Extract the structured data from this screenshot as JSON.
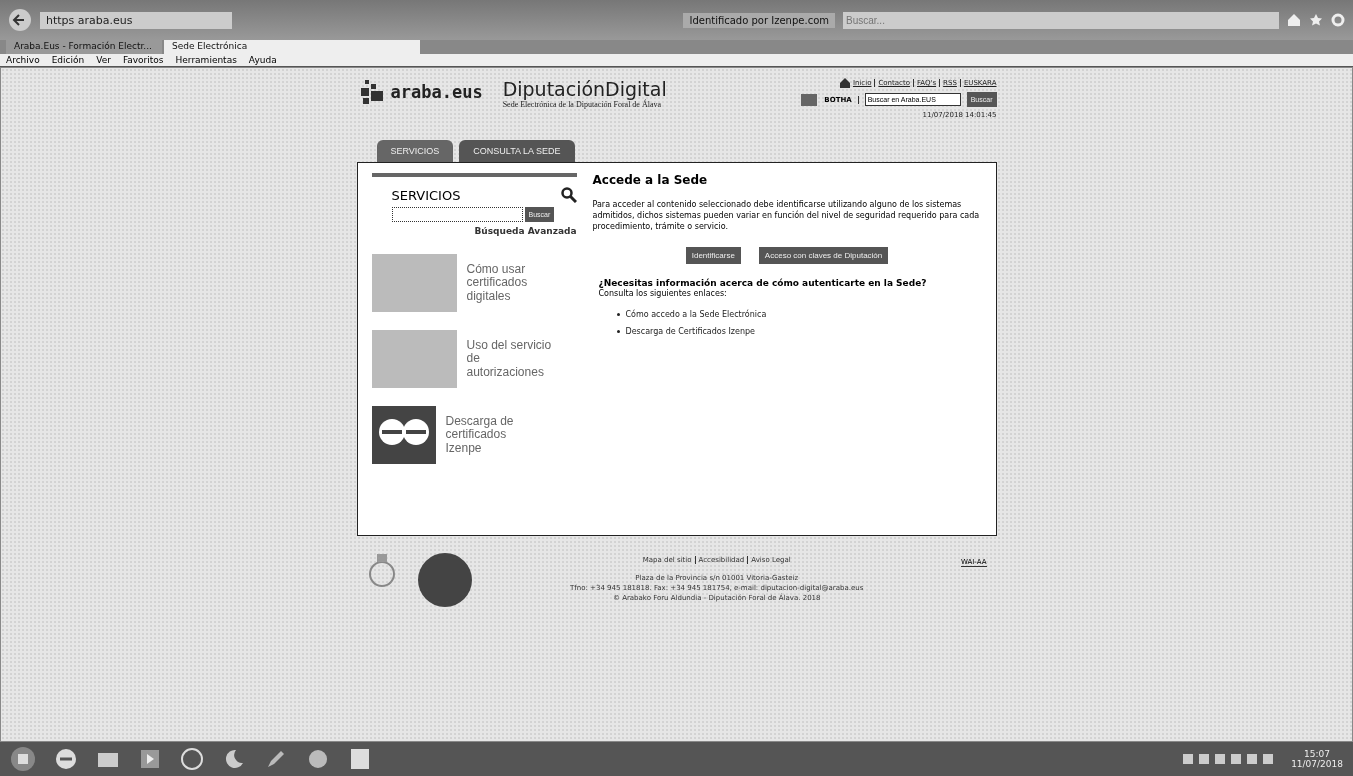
{
  "browser": {
    "address": "https   araba.eus",
    "identity": "Identificado por Izenpe.com",
    "search": {
      "placeholder": "Buscar..."
    },
    "tabs": [
      {
        "label": "Araba.Eus - Formación Electr...",
        "selected": false
      },
      {
        "label": "Sede Electrónica",
        "selected": true
      }
    ],
    "menu": [
      "Archivo",
      "Edición",
      "Ver",
      "Favoritos",
      "Herramientas",
      "Ayuda"
    ]
  },
  "header": {
    "logo": "araba.eus",
    "title": "DiputaciónDigital",
    "subtitle": "Sede Electrónica de la Diputación Foral de Álava",
    "links": [
      "Inicio",
      "Contacto",
      "FAQ's",
      "RSS",
      "EUSKARA"
    ],
    "botha": "BOTHA",
    "search": {
      "value": "Buscar en Araba.EUS"
    },
    "search_button": "Buscar",
    "datetime": "11/07/2018 14:01:45",
    "tabs": [
      {
        "label": "SERVICIOS",
        "selected": false
      },
      {
        "label": "CONSULTA LA SEDE",
        "selected": true
      }
    ]
  },
  "sidebar": {
    "title": "SERVICIOS",
    "search_button": "Buscar",
    "advanced": "Búsqueda Avanzada",
    "items": [
      {
        "kind": "photo",
        "label": "Cómo usar certificados digitales"
      },
      {
        "kind": "photo",
        "label": "Uso del servicio de autorizaciones"
      },
      {
        "kind": "logo",
        "label": "Descarga de certificados Izenpe"
      }
    ]
  },
  "main": {
    "title": "Accede a la Sede",
    "text": "Para acceder al contenido seleccionado debe identificarse utilizando alguno de los sistemas admitidos, dichos sistemas pueden variar en función del nivel de seguridad requerido para cada procedimiento, trámite o servicio.",
    "buttons": [
      "Identificarse",
      "Acceso con claves de Diputación"
    ],
    "question": "¿Necesitas información acerca de cómo autenticarte en la Sede?",
    "hint": "Consulta los siguientes enlaces:",
    "links": [
      "Cómo accedo a la Sede Electrónica",
      "Descarga de Certificados Izenpe"
    ]
  },
  "footer": {
    "links": [
      "Mapa del sitio",
      "Accesibilidad",
      "Aviso Legal"
    ],
    "lines": [
      "Plaza de la Provincia s/n 01001 Vitoria-Gasteiz",
      "Tfno: +34 945 181818. Fax: +34 945 181754, e-mail: diputacion-digital@araba.eus",
      "© Arabako Foru Aldundia - Diputación Foral de Álava. 2018"
    ],
    "badge": "WAI-AA"
  },
  "taskbar": {
    "time": "15:07",
    "date": "11/07/2018"
  }
}
